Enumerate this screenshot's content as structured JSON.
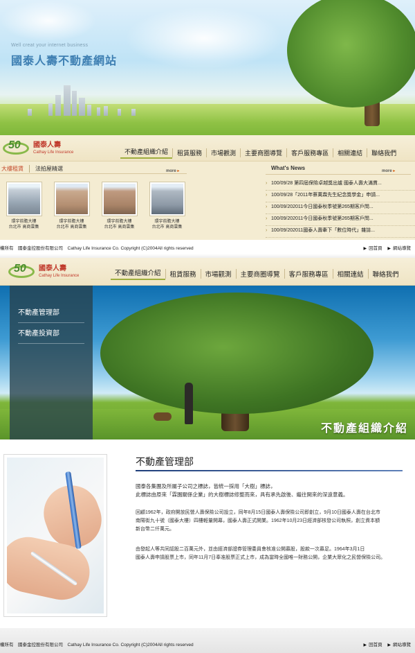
{
  "hero": {
    "tagline": "Well creat your internet business",
    "site_title": "國泰人壽不動產網站"
  },
  "brand": {
    "logo_number": "50",
    "name_zh": "國泰人壽",
    "name_en": "Cathay Life Insurance",
    "accent_green": "#4b8d2f",
    "accent_red": "#c0392b"
  },
  "nav": {
    "items": [
      "不動產組織介紹",
      "租賃服務",
      "市場觀測",
      "主要商圈導覽",
      "客戶服務專區",
      "相關連結",
      "聯絡我們"
    ]
  },
  "listing": {
    "tab_active": "大樓租賃",
    "tab_other": "法拍屋精選",
    "more_label": "more",
    "properties": [
      {
        "name": "環宇前瞻大樓",
        "location": "台北市 高商雲集"
      },
      {
        "name": "環宇前瞻大樓",
        "location": "台北市 高商雲集"
      },
      {
        "name": "環宇前瞻大樓",
        "location": "台北市 高商雲集"
      },
      {
        "name": "環宇前瞻大樓",
        "location": "台北市 高商雲集"
      }
    ]
  },
  "news": {
    "title": "What's News",
    "more_label": "more",
    "items": [
      "100/09/28 第四屆保險卓越獎出爐 國泰人壽大滿貫...",
      "100/09/28「2011年蔡萬霖先生紀念獎學金」申請...",
      "100/09/202011今日國泰秋季號第265期客戶問...",
      "100/09/202011今日國泰秋季號第265期客戶問...",
      "100/09/202011國泰人壽牽下「數位時代」雜誌..."
    ]
  },
  "footer": {
    "copyright_1": "權所有　國泰金控股份有限公司　Cathay Life Insurance Co. Copyright (C)2004All rights reserved",
    "copyright_2": "權所有　國泰金控股份有限公司　Cathay Life Insurance Co. Copyright (C)2004All rights reserved",
    "home_link": "回首頁",
    "sitemap_link": "網站導覽"
  },
  "banner": {
    "side_items": [
      "不動產管理部",
      "不動產投資部"
    ],
    "caption": "不動產組織介紹"
  },
  "section": {
    "title": "不動產管理部",
    "lead_1": "國泰各集團及所屬子公司之標誌，皆統一採用「大樹」標誌，",
    "lead_2": "此標誌由原來「霖園關係企業」的大樹標誌修整而來，具有承先啟後、繼往開來的深遠意義。",
    "p2_1": "回顧1962年，政府開放民營人壽保險公司設立，同年8月15日國泰人壽保險公司即創立，9月10日國泰人壽在台北市",
    "p2_2": "南陽街九十號（國泰大樓）四樓輕量開幕，國泰人壽正式開業。1962年10月23日經濟部核發公司執照，創立資本額",
    "p2_3": "新台幣二仟萬元。",
    "p3_1": "由發起人等共同認股二百萬元外，並由經濟部證券管理委員會核准公開募股，股款一次募足。1964年3月1日",
    "p3_2": "國泰人壽申請股票上市，同年11月7日奉准股票正式上市，成為當時全國唯一財務公開，企業大眾化之民營保險公司。"
  }
}
